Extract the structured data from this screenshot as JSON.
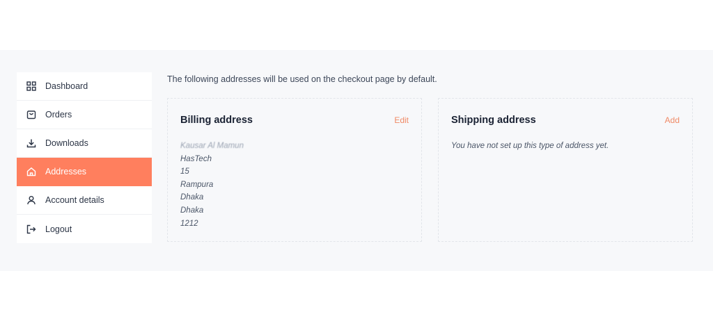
{
  "nav": {
    "items": [
      {
        "label": "Dashboard",
        "icon": "grid-icon"
      },
      {
        "label": "Orders",
        "icon": "shopping-bag-icon"
      },
      {
        "label": "Downloads",
        "icon": "download-icon"
      },
      {
        "label": "Addresses",
        "icon": "home-icon",
        "active": true
      },
      {
        "label": "Account details",
        "icon": "user-icon"
      },
      {
        "label": "Logout",
        "icon": "logout-icon"
      }
    ]
  },
  "intro_text": "The following addresses will be used on the checkout page by default.",
  "billing": {
    "title": "Billing address",
    "action": "Edit",
    "lines": [
      "Kausar Al Mamun",
      "HasTech",
      "15",
      "Rampura",
      "Dhaka",
      "Dhaka",
      "1212"
    ]
  },
  "shipping": {
    "title": "Shipping address",
    "action": "Add",
    "message": "You have not set up this type of address yet."
  },
  "colors": {
    "accent": "#ff7f5e",
    "link": "#f08a66",
    "band_bg": "#f7f8fa"
  }
}
